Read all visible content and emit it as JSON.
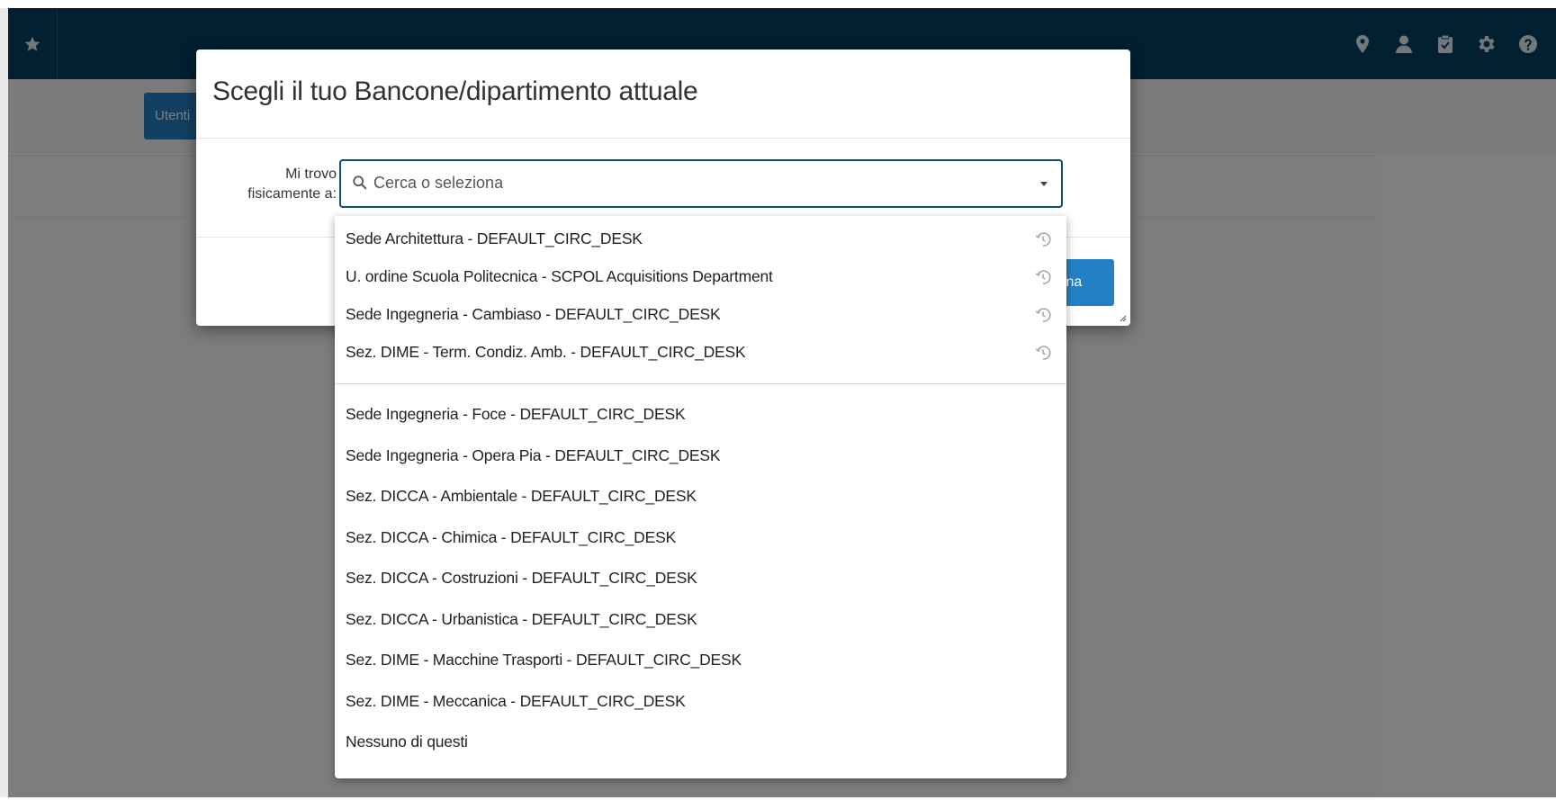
{
  "colors": {
    "topbar": "#034065",
    "accent": "#2480c4",
    "overlay": "rgba(0,0,0,0.5)"
  },
  "header": {
    "left_icon": "star-icon",
    "right_icons": [
      "location-pin-icon",
      "user-icon",
      "clipboard-check-icon",
      "gear-icon",
      "help-circle-icon"
    ]
  },
  "page": {
    "users_button_label": "Utenti"
  },
  "modal": {
    "title": "Scegli il tuo Bancone/dipartimento attuale",
    "field_label_line1": "Mi trovo",
    "field_label_line2": "fisicamente a:",
    "search_placeholder": "Cerca o seleziona",
    "submit_label": "ziona"
  },
  "dropdown": {
    "recent": [
      "Sede Architettura - DEFAULT_CIRC_DESK",
      "U. ordine Scuola Politecnica - SCPOL Acquisitions Department",
      "Sede Ingegneria - Cambiaso - DEFAULT_CIRC_DESK",
      "Sez. DIME - Term. Condiz. Amb. - DEFAULT_CIRC_DESK"
    ],
    "options": [
      "Sede Ingegneria - Foce - DEFAULT_CIRC_DESK",
      "Sede Ingegneria - Opera Pia - DEFAULT_CIRC_DESK",
      "Sez. DICCA - Ambientale - DEFAULT_CIRC_DESK",
      "Sez. DICCA - Chimica - DEFAULT_CIRC_DESK",
      "Sez. DICCA - Costruzioni - DEFAULT_CIRC_DESK",
      "Sez. DICCA - Urbanistica - DEFAULT_CIRC_DESK",
      "Sez. DIME - Macchine Trasporti - DEFAULT_CIRC_DESK",
      "Sez. DIME - Meccanica - DEFAULT_CIRC_DESK",
      "Nessuno di questi"
    ]
  }
}
